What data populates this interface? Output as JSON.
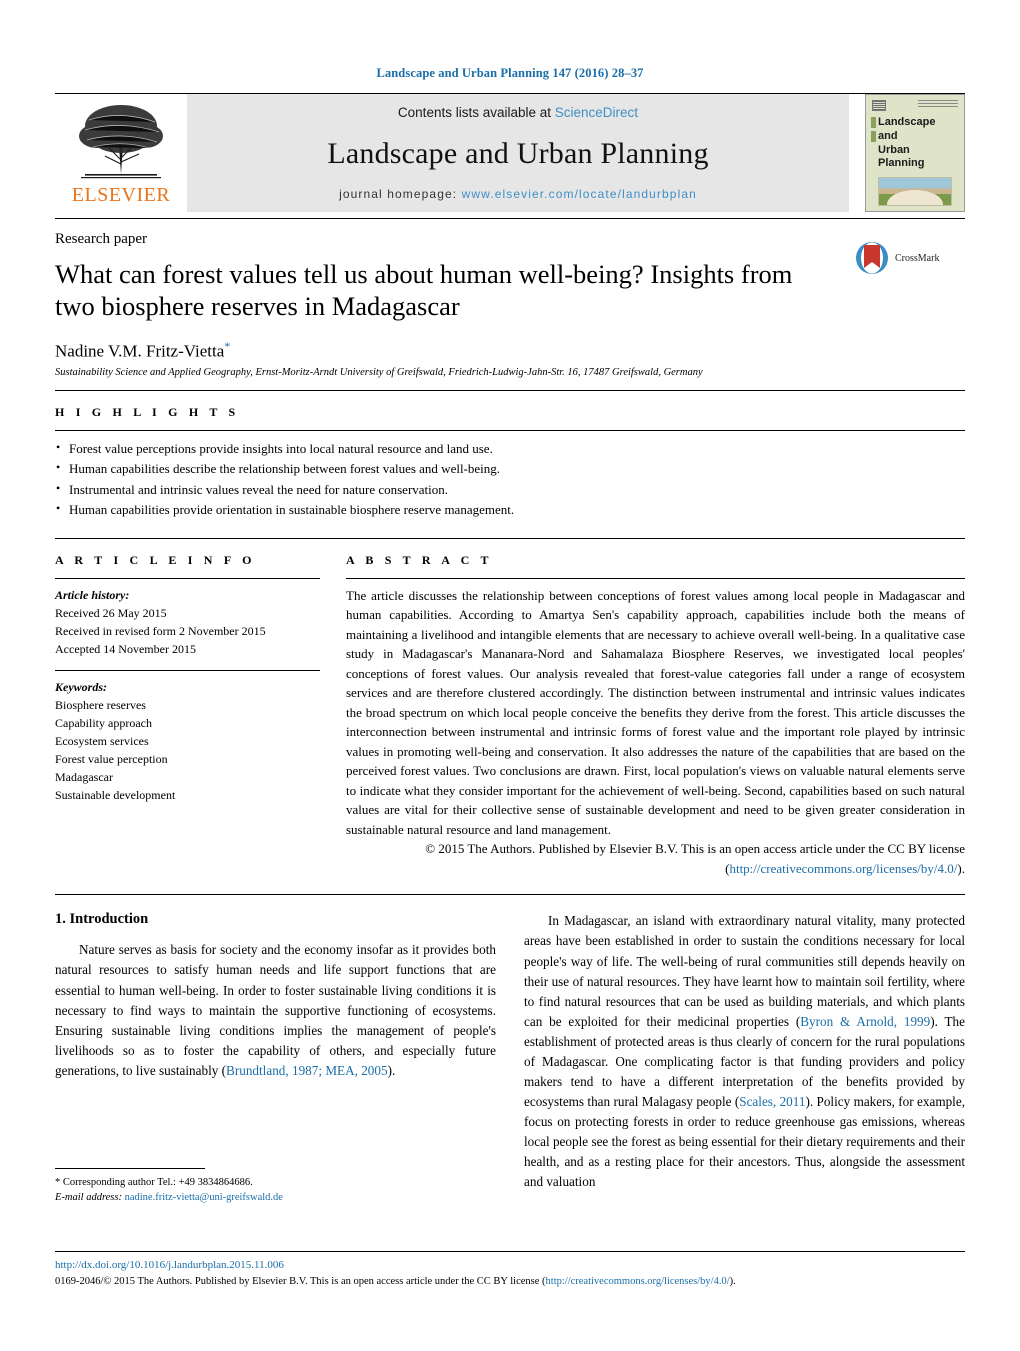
{
  "running_head": "Landscape and Urban Planning 147 (2016) 28–37",
  "masthead": {
    "contents_prefix": "Contents lists available at",
    "contents_link": "ScienceDirect",
    "journal_title": "Landscape and Urban Planning",
    "homepage_label": "journal homepage:",
    "homepage_url": "www.elsevier.com/locate/landurbplan",
    "publisher_name": "ELSEVIER",
    "cover_title_line1": "Landscape and",
    "cover_title_line2": "Urban Planning"
  },
  "article": {
    "type": "Research paper",
    "title": "What can forest values tell us about human well-being? Insights from two biosphere reserves in Madagascar",
    "author": "Nadine V.M. Fritz-Vietta",
    "author_marker": "*",
    "affiliation": "Sustainability Science and Applied Geography, Ernst-Moritz-Arndt University of Greifswald, Friedrich-Ludwig-Jahn-Str. 16, 17487 Greifswald, Germany",
    "crossmark_label": "CrossMark"
  },
  "highlights": {
    "heading": "H I G H L I G H T S",
    "items": [
      "Forest value perceptions provide insights into local natural resource and land use.",
      "Human capabilities describe the relationship between forest values and well-being.",
      "Instrumental and intrinsic values reveal the need for nature conservation.",
      "Human capabilities provide orientation in sustainable biosphere reserve management."
    ]
  },
  "article_info": {
    "heading": "A R T I C L E    I N F O",
    "history_label": "Article history:",
    "history": [
      "Received 26 May 2015",
      "Received in revised form 2 November 2015",
      "Accepted 14 November 2015"
    ],
    "keywords_label": "Keywords:",
    "keywords": [
      "Biosphere reserves",
      "Capability approach",
      "Ecosystem services",
      "Forest value perception",
      "Madagascar",
      "Sustainable development"
    ]
  },
  "abstract": {
    "heading": "A B S T R A C T",
    "text": "The article discusses the relationship between conceptions of forest values among local people in Madagascar and human capabilities. According to Amartya Sen's capability approach, capabilities include both the means of maintaining a livelihood and intangible elements that are necessary to achieve overall well-being. In a qualitative case study in Madagascar's Mananara-Nord and Sahamalaza Biosphere Reserves, we investigated local peoples' conceptions of forest values. Our analysis revealed that forest-value categories fall under a range of ecosystem services and are therefore clustered accordingly. The distinction between instrumental and intrinsic values indicates the broad spectrum on which local people conceive the benefits they derive from the forest. This article discusses the interconnection between instrumental and intrinsic forms of forest value and the important role played by intrinsic values in promoting well-being and conservation. It also addresses the nature of the capabilities that are based on the perceived forest values. Two conclusions are drawn. First, local population's views on valuable natural elements serve to indicate what they consider important for the achievement of well-being. Second, capabilities based on such natural values are vital for their collective sense of sustainable development and need to be given greater consideration in sustainable natural resource and land management.",
    "copyright": "© 2015 The Authors. Published by Elsevier B.V. This is an open access article under the CC BY license",
    "license_open": "(",
    "license_url": "http://creativecommons.org/licenses/by/4.0/",
    "license_close": ")."
  },
  "body": {
    "section_number_title": "1.  Introduction",
    "left_paragraph_part1": "Nature serves as basis for society and the economy insofar as it provides both natural resources to satisfy human needs and life support functions that are essential to human well-being. In order to foster sustainable living conditions it is necessary to find ways to maintain the supportive functioning of ecosystems. Ensuring sustainable living conditions implies the management of people's livelihoods so as to foster the capability of others, and especially future generations, to live sustainably (",
    "left_citation1": "Brundtland, 1987; MEA, 2005",
    "left_paragraph_part2": ").",
    "right_paragraph_part1": "In Madagascar, an island with extraordinary natural vitality, many protected areas have been established in order to sustain the conditions necessary for local people's way of life. The well-being of rural communities still depends heavily on their use of natural resources. They have learnt how to maintain soil fertility, where to find natural resources that can be used as building materials, and which plants can be exploited for their medicinal properties (",
    "right_citation1": "Byron & Arnold, 1999",
    "right_paragraph_part2": "). The establishment of protected areas is thus clearly of concern for the rural populations of Madagascar. One complicating factor is that funding providers and policy makers tend to have a different interpretation of the benefits provided by ecosystems than rural Malagasy people (",
    "right_citation2": "Scales, 2011",
    "right_paragraph_part3": "). Policy makers, for example, focus on protecting forests in order to reduce greenhouse gas emissions, whereas local people see the forest as being essential for their dietary requirements and their health, and as a resting place for their ancestors. Thus, alongside the assessment and valuation"
  },
  "footnote": {
    "corresponding": "* Corresponding author Tel.: +49 3834864686.",
    "email_label": "E-mail address:",
    "email": "nadine.fritz-vietta@uni-greifswald.de"
  },
  "footer": {
    "doi": "http://dx.doi.org/10.1016/j.landurbplan.2015.11.006",
    "legal_prefix": "0169-2046/© 2015 The Authors. Published by Elsevier B.V. This is an open access article under the CC BY license (",
    "legal_link": "http://creativecommons.org/licenses/by/4.0/",
    "legal_suffix": ")."
  },
  "colors": {
    "link": "#1a6ea8",
    "elsevier_orange": "#e8741c",
    "masthead_gray": "#e6e6e6"
  }
}
